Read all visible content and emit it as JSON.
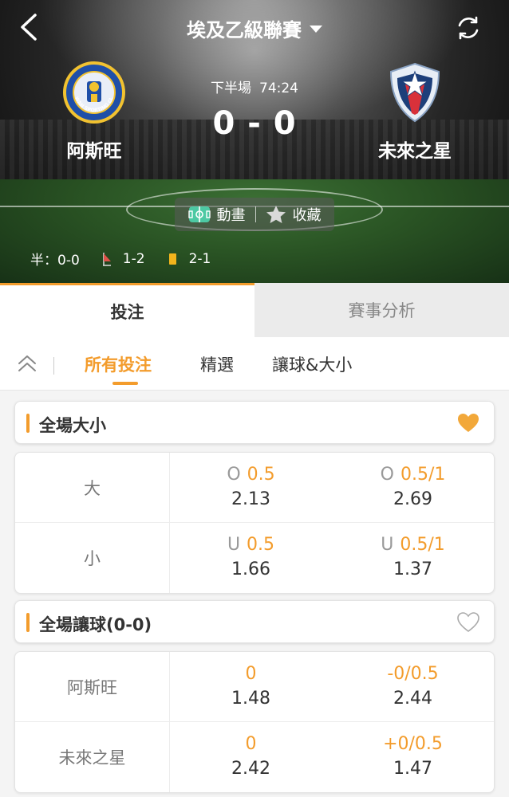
{
  "header": {
    "title": "埃及乙級聯賽",
    "back_icon": "chevron-left-icon",
    "refresh_icon": "refresh-icon"
  },
  "match": {
    "period": "下半場",
    "clock": "74:24",
    "score": "0 - 0",
    "home_team": "阿斯旺",
    "away_team": "未來之星",
    "home_logo_text": "ASWAN SPORTING CLUB",
    "stats": {
      "half_label": "半：0-0",
      "corners": "1-2",
      "yellow_cards": "2-1"
    },
    "actions": {
      "animation_label": "動畫",
      "favorite_label": "收藏"
    }
  },
  "main_tabs": [
    {
      "label": "投注",
      "active": true
    },
    {
      "label": "賽事分析",
      "active": false
    }
  ],
  "sub_tabs": [
    {
      "label": "所有投注",
      "active": true
    },
    {
      "label": "精選",
      "active": false
    },
    {
      "label": "讓球&大小",
      "active": false
    }
  ],
  "markets": [
    {
      "title": "全場大小",
      "favorited": true,
      "rows": [
        {
          "label": "大",
          "cells": [
            {
              "prefix": "O",
              "line": "0.5",
              "odds": "2.13"
            },
            {
              "prefix": "O",
              "line": "0.5/1",
              "odds": "2.69"
            }
          ]
        },
        {
          "label": "小",
          "cells": [
            {
              "prefix": "U",
              "line": "0.5",
              "odds": "1.66"
            },
            {
              "prefix": "U",
              "line": "0.5/1",
              "odds": "1.37"
            }
          ]
        }
      ]
    },
    {
      "title": "全場讓球(0-0)",
      "favorited": false,
      "rows": [
        {
          "label": "阿斯旺",
          "cells": [
            {
              "prefix": "",
              "line": "0",
              "odds": "1.48"
            },
            {
              "prefix": "",
              "line": "-0/0.5",
              "odds": "2.44"
            }
          ]
        },
        {
          "label": "未來之星",
          "cells": [
            {
              "prefix": "",
              "line": "0",
              "odds": "2.42"
            },
            {
              "prefix": "",
              "line": "+0/0.5",
              "odds": "1.47"
            }
          ]
        }
      ]
    }
  ],
  "colors": {
    "accent": "#f39c2c",
    "card_yellow": "#f2b41c",
    "corner_red": "#e0524a"
  }
}
